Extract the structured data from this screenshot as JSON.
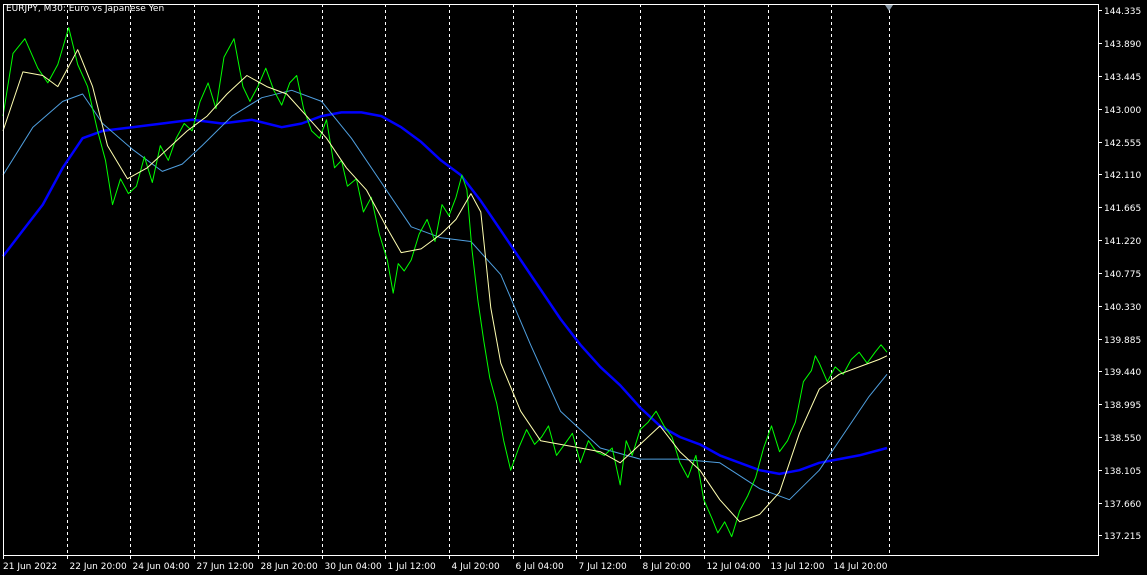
{
  "title": "EURJPY, M30:  Euro vs Japanese Yen",
  "colors": {
    "background": "#000000",
    "frame": "#ffffff",
    "grid": "#ffffff",
    "price": "#00ff00",
    "ma_fast": "#ffffb0",
    "ma_mid": "#4f9fdf",
    "ma_slow": "#0000ff",
    "text": "#ffffff",
    "marker": "#8a9aa8"
  },
  "chart_data": {
    "type": "line",
    "title": "EURJPY, M30:  Euro vs Japanese Yen",
    "symbol": "EURJPY",
    "timeframe": "M30",
    "xlabel": "",
    "ylabel": "",
    "ylim": [
      136.95,
      144.42
    ],
    "grid": "vertical-dashed",
    "y_axis_position": "right",
    "y_ticks": [
      144.335,
      143.89,
      143.445,
      143.0,
      142.555,
      142.11,
      141.665,
      141.22,
      140.775,
      140.33,
      139.885,
      139.44,
      138.995,
      138.55,
      138.105,
      137.66,
      137.215
    ],
    "y_tick_labels": [
      "144.335",
      "143.890",
      "143.445",
      "143.000",
      "142.555",
      "142.110",
      "141.665",
      "141.220",
      "140.775",
      "140.330",
      "139.885",
      "139.440",
      "138.995",
      "138.550",
      "138.105",
      "137.660",
      "137.215"
    ],
    "x_tick_labels": [
      "21 Jun 2022",
      "22 Jun 20:00",
      "24 Jun 04:00",
      "27 Jun 12:00",
      "28 Jun 20:00",
      "30 Jun 04:00",
      "1 Jul 12:00",
      "4 Jul 20:00",
      "6 Jul 04:00",
      "7 Jul 12:00",
      "8 Jul 20:00",
      "12 Jul 04:00",
      "13 Jul 12:00",
      "14 Jul 20:00"
    ],
    "x_tick_bars": [
      0,
      64,
      128,
      192,
      256,
      320,
      384,
      448,
      512,
      576,
      640,
      704,
      768,
      832
    ],
    "bar_count": 890,
    "series": [
      {
        "role": "price",
        "bars": [
          0,
          10,
          22,
          35,
          45,
          55,
          66,
          75,
          85,
          95,
          103,
          110,
          118,
          126,
          134,
          142,
          150,
          158,
          166,
          174,
          182,
          190,
          198,
          206,
          214,
          222,
          232,
          241,
          248,
          256,
          264,
          272,
          280,
          288,
          295,
          302,
          310,
          318,
          325,
          333,
          340,
          346,
          355,
          362,
          370,
          378,
          386,
          392,
          397,
          403,
          410,
          418,
          426,
          434,
          441,
          448,
          455,
          461,
          466,
          471,
          477,
          483,
          489,
          496,
          503,
          510,
          518,
          526,
          534,
          541,
          548,
          556,
          564,
          572,
          580,
          588,
          596,
          604,
          612,
          620,
          626,
          632,
          640,
          648,
          656,
          664,
          672,
          680,
          688,
          696,
          704,
          712,
          718,
          725,
          732,
          740,
          748,
          756,
          764,
          772,
          780,
          788,
          796,
          804,
          812,
          816,
          820,
          828,
          836,
          844,
          852,
          860,
          868,
          876,
          882,
          888
        ],
        "values": [
          142.9,
          143.75,
          143.95,
          143.55,
          143.35,
          143.6,
          144.1,
          143.6,
          143.3,
          142.7,
          142.3,
          141.7,
          142.05,
          141.85,
          141.95,
          142.35,
          142.0,
          142.5,
          142.3,
          142.6,
          142.8,
          142.7,
          143.1,
          143.35,
          143.0,
          143.7,
          143.95,
          143.3,
          143.1,
          143.3,
          143.55,
          143.25,
          143.05,
          143.35,
          143.45,
          143.0,
          142.7,
          142.6,
          142.85,
          142.2,
          142.3,
          141.95,
          142.05,
          141.6,
          141.8,
          141.3,
          140.95,
          140.5,
          140.9,
          140.8,
          140.95,
          141.3,
          141.5,
          141.2,
          141.7,
          141.55,
          141.8,
          142.1,
          141.9,
          141.1,
          140.4,
          139.85,
          139.35,
          139.0,
          138.5,
          138.1,
          138.4,
          138.65,
          138.45,
          138.55,
          138.7,
          138.3,
          138.45,
          138.6,
          138.2,
          138.5,
          138.35,
          138.3,
          138.4,
          137.9,
          138.5,
          138.3,
          138.65,
          138.75,
          138.9,
          138.7,
          138.55,
          138.2,
          138.0,
          138.3,
          137.7,
          137.45,
          137.25,
          137.4,
          137.2,
          137.55,
          137.75,
          138.0,
          138.4,
          138.7,
          138.35,
          138.5,
          138.75,
          139.3,
          139.45,
          139.65,
          139.55,
          139.3,
          139.5,
          139.4,
          139.6,
          139.7,
          139.55,
          139.7,
          139.8,
          139.7
        ]
      },
      {
        "role": "ma_fast",
        "bars": [
          0,
          20,
          40,
          55,
          75,
          90,
          105,
          125,
          145,
          165,
          185,
          205,
          225,
          245,
          265,
          285,
          305,
          325,
          345,
          365,
          385,
          400,
          420,
          440,
          455,
          470,
          480,
          490,
          500,
          520,
          540,
          560,
          580,
          600,
          620,
          640,
          660,
          680,
          700,
          720,
          740,
          760,
          780,
          800,
          820,
          840,
          860,
          880,
          888
        ],
        "values": [
          142.7,
          143.5,
          143.45,
          143.3,
          143.8,
          143.3,
          142.5,
          142.05,
          142.2,
          142.45,
          142.7,
          142.9,
          143.2,
          143.45,
          143.3,
          143.2,
          142.9,
          142.6,
          142.2,
          141.9,
          141.4,
          141.05,
          141.1,
          141.3,
          141.5,
          141.85,
          141.6,
          140.3,
          139.55,
          138.9,
          138.5,
          138.45,
          138.4,
          138.35,
          138.2,
          138.45,
          138.7,
          138.35,
          138.1,
          137.7,
          137.4,
          137.5,
          137.8,
          138.6,
          139.2,
          139.4,
          139.5,
          139.6,
          139.65
        ]
      },
      {
        "role": "ma_mid",
        "bars": [
          0,
          30,
          60,
          80,
          100,
          130,
          160,
          180,
          200,
          230,
          260,
          290,
          320,
          350,
          380,
          410,
          440,
          470,
          500,
          530,
          560,
          600,
          640,
          680,
          720,
          760,
          790,
          820,
          850,
          870,
          888
        ],
        "values": [
          142.1,
          142.75,
          143.1,
          143.2,
          142.8,
          142.45,
          142.15,
          142.25,
          142.5,
          142.9,
          143.15,
          143.25,
          143.1,
          142.6,
          142.0,
          141.4,
          141.25,
          141.2,
          140.75,
          139.8,
          138.9,
          138.4,
          138.25,
          138.25,
          138.2,
          137.85,
          137.7,
          138.1,
          138.7,
          139.1,
          139.4
        ]
      },
      {
        "role": "ma_slow",
        "bars": [
          0,
          20,
          40,
          60,
          80,
          100,
          130,
          160,
          190,
          220,
          250,
          280,
          300,
          320,
          340,
          360,
          380,
          400,
          420,
          440,
          460,
          480,
          500,
          520,
          540,
          560,
          580,
          600,
          620,
          640,
          660,
          680,
          700,
          720,
          740,
          760,
          780,
          800,
          820,
          840,
          860,
          888
        ],
        "values": [
          141.0,
          141.35,
          141.7,
          142.2,
          142.6,
          142.7,
          142.75,
          142.8,
          142.85,
          142.8,
          142.85,
          142.75,
          142.8,
          142.9,
          142.95,
          142.95,
          142.9,
          142.75,
          142.55,
          142.3,
          142.1,
          141.75,
          141.35,
          140.95,
          140.55,
          140.15,
          139.8,
          139.5,
          139.25,
          138.95,
          138.7,
          138.55,
          138.45,
          138.3,
          138.2,
          138.1,
          138.05,
          138.1,
          138.2,
          138.25,
          138.3,
          138.4
        ]
      }
    ]
  }
}
